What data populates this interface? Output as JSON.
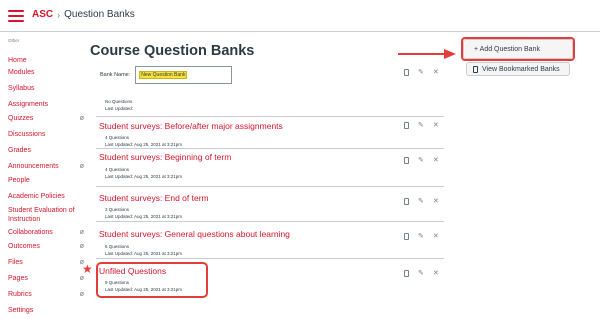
{
  "header": {
    "course": "ASC",
    "separator": "›",
    "current": "Question Banks"
  },
  "sidebar": {
    "section_label": "Other",
    "items": [
      {
        "label": "Home",
        "hidden": false
      },
      {
        "label": "Modules",
        "hidden": false
      },
      {
        "label": "Syllabus",
        "hidden": false
      },
      {
        "label": "Assignments",
        "hidden": false
      },
      {
        "label": "Quizzes",
        "hidden": true
      },
      {
        "label": "Discussions",
        "hidden": false
      },
      {
        "label": "Grades",
        "hidden": false
      },
      {
        "label": "Announcements",
        "hidden": true
      },
      {
        "label": "People",
        "hidden": false
      },
      {
        "label": "Academic Policies",
        "hidden": false
      },
      {
        "label": "Student Evaluation of Instruction",
        "hidden": false
      },
      {
        "label": "Collaborations",
        "hidden": true
      },
      {
        "label": "Outcomes",
        "hidden": true
      },
      {
        "label": "Files",
        "hidden": true
      },
      {
        "label": "Pages",
        "hidden": true
      },
      {
        "label": "Rubrics",
        "hidden": true
      },
      {
        "label": "Settings",
        "hidden": false
      }
    ]
  },
  "main": {
    "title": "Course Question Banks",
    "add_button": "+ Add Question Bank",
    "bookmarked_button": "View Bookmarked Banks",
    "bank_name_label": "Bank Name:",
    "bank_name_value": "New Question Bank",
    "new_bank": {
      "count": "No Questions",
      "updated": "Last Updated:"
    },
    "banks": [
      {
        "title": "Student surveys: Before/after major assignments",
        "count": "4 Questions",
        "updated": "Last Updated: Aug 25, 2021 at 3:21pm"
      },
      {
        "title": "Student surveys: Beginning of term",
        "count": "4 Questions",
        "updated": "Last Updated: Aug 25, 2021 at 3:21pm"
      },
      {
        "title": "Student surveys: End of term",
        "count": "3 Questions",
        "updated": "Last Updated: Aug 25, 2021 at 3:21pm"
      },
      {
        "title": "Student surveys: General questions about learning",
        "count": "6 Questions",
        "updated": "Last Updated: Aug 25, 2021 at 3:21pm"
      },
      {
        "title": "Unfiled Questions",
        "count": "9 Questions",
        "updated": "Last Updated: Aug 25, 2021 at 3:21pm"
      }
    ]
  },
  "icons": {
    "eye_off": "eye-off-icon",
    "bookmark": "bookmark-icon",
    "pencil": "pencil-icon",
    "close": "close-icon",
    "annotation_arrow": "arrow-right-icon",
    "annotation_star": "star-icon"
  },
  "colors": {
    "brand": "#d5152b",
    "annotation": "#e43b3b",
    "text": "#2d3b45",
    "muted": "#73818c",
    "highlight": "#f7e23b"
  }
}
